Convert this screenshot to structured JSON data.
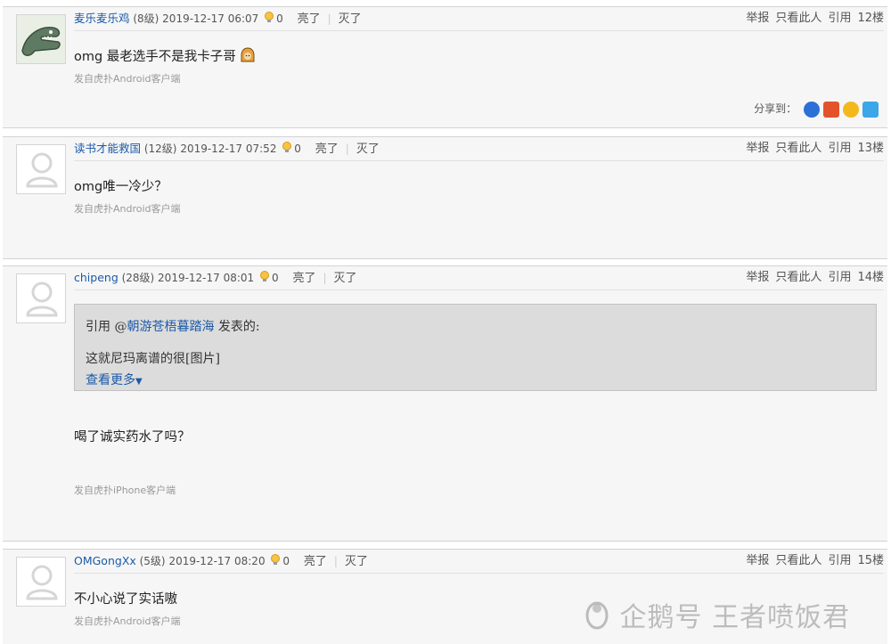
{
  "posts": [
    {
      "username": "麦乐麦乐鸡",
      "level": "(8级)",
      "time": "2019-12-17 06:07",
      "light_count": "0",
      "light_label": "亮了",
      "dark_label": "灭了",
      "actions": [
        "举报",
        "只看此人",
        "引用"
      ],
      "floor": "12楼",
      "content": "omg 最老选手不是我卡子哥",
      "source": "发自虎扑Android客户端",
      "share_label": "分享到："
    },
    {
      "username": "读书才能救国",
      "level": "(12级)",
      "time": "2019-12-17 07:52",
      "light_count": "0",
      "light_label": "亮了",
      "dark_label": "灭了",
      "actions": [
        "举报",
        "只看此人",
        "引用"
      ],
      "floor": "13楼",
      "content": "omg唯一冷少？",
      "source": "发自虎扑Android客户端"
    },
    {
      "username": "chipeng",
      "level": "(28级)",
      "time": "2019-12-17 08:01",
      "light_count": "0",
      "light_label": "亮了",
      "dark_label": "灭了",
      "actions": [
        "举报",
        "只看此人",
        "引用"
      ],
      "floor": "14楼",
      "quote": {
        "prefix": "引用 @",
        "name": "朝游苍梧暮踏海",
        "suffix": " 发表的:",
        "text": "这就尼玛离谱的很[图片]",
        "more": "查看更多"
      },
      "content": "喝了诚实药水了吗？",
      "source": "发自虎扑iPhone客户端"
    },
    {
      "username": "OMGongXx",
      "level": "(5级)",
      "time": "2019-12-17 08:20",
      "light_count": "0",
      "light_label": "亮了",
      "dark_label": "灭了",
      "actions": [
        "举报",
        "只看此人",
        "引用"
      ],
      "floor": "15楼",
      "content": "不小心说了实话嗷",
      "source": "发自虎扑Android客户端"
    }
  ],
  "watermark": "企鹅号 王者喷饭君"
}
